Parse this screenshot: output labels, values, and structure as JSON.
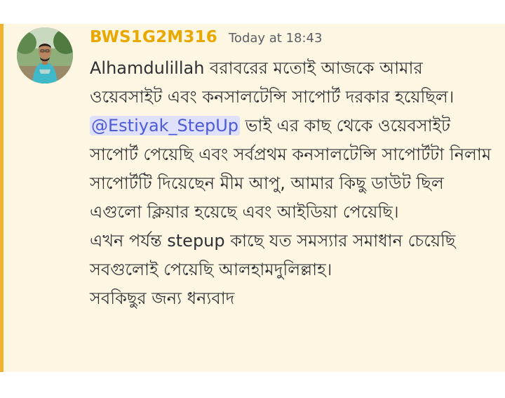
{
  "message": {
    "author": "BWS1G2M316",
    "timestamp": "Today at 18:43",
    "line1": "Alhamdulillah বরাবরের মতোই আজকে আমার ওয়েবসাইট এবং কনসালটেন্সি সাপোর্ট দরকার হয়েছিল।",
    "mention": "@Estiyak_StepUp",
    "line2_rest": " ভাই এর কাছ থেকে ওয়েবসাইট সাপোর্ট পেয়েছি এবং সর্বপ্রথম কনসালটেন্সি সাপোর্টটা নিলাম সাপোর্টটি দিয়েছেন মীম আপু, আমার কিছু ডাউট ছিল এগুলো ক্লিয়ার হয়েছে এবং আইডিয়া পেয়েছি।",
    "line3": "এখন পর্যন্ত stepup কাছে যত সমস্যার সমাধান চেয়েছি সবগুলোই পেয়েছি আলহামদুলিল্লাহ।",
    "line4": "সবকিছুর জন্য ধন্যবাদ"
  },
  "colors": {
    "accent": "#f0b232",
    "username": "#e8a800",
    "mention_bg": "#dee0fc",
    "mention_text": "#4e5bd6",
    "highlight_bg": "#fdf6e3"
  }
}
